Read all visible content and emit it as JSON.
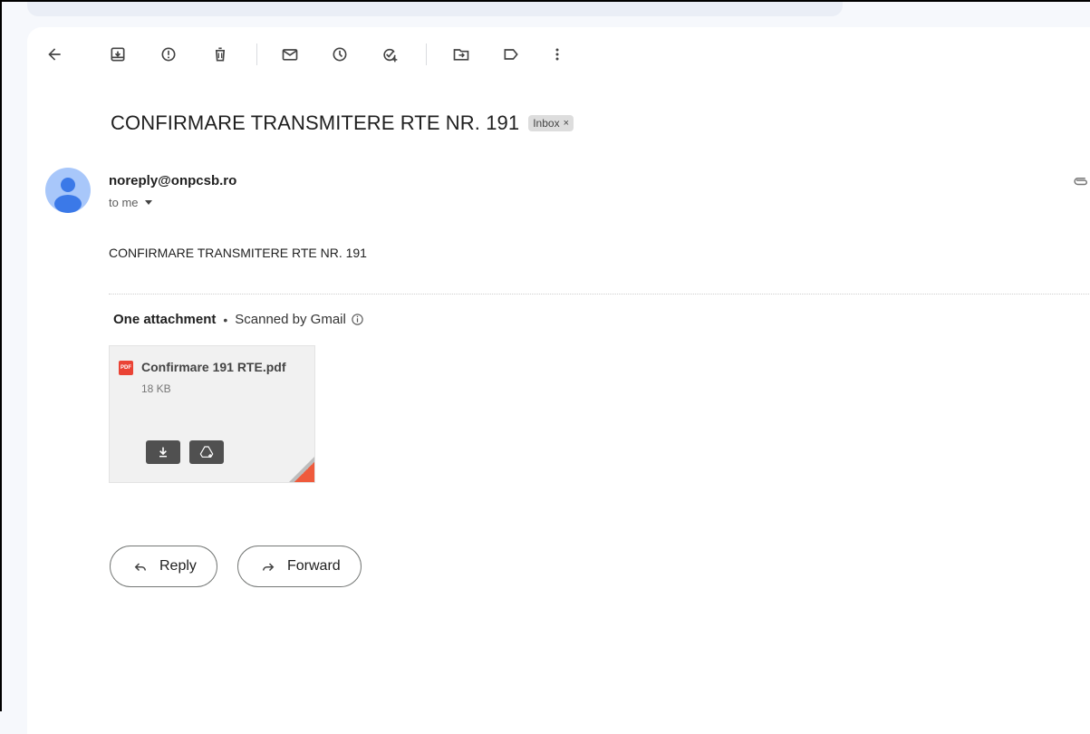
{
  "toolbar": {
    "buttons": [
      {
        "name": "back",
        "icon": "arrow-left-icon",
        "label": "Back"
      },
      {
        "name": "archive",
        "icon": "archive-icon",
        "label": "Archive"
      },
      {
        "name": "report-spam",
        "icon": "report-spam-icon",
        "label": "Report spam"
      },
      {
        "name": "delete",
        "icon": "trash-icon",
        "label": "Delete"
      },
      {
        "name": "mark-unread",
        "icon": "envelope-icon",
        "label": "Mark as unread"
      },
      {
        "name": "snooze",
        "icon": "clock-icon",
        "label": "Snooze"
      },
      {
        "name": "add-to-tasks",
        "icon": "add-task-icon",
        "label": "Add to Tasks"
      },
      {
        "name": "move-to",
        "icon": "move-folder-icon",
        "label": "Move to"
      },
      {
        "name": "labels",
        "icon": "label-icon",
        "label": "Labels"
      },
      {
        "name": "more",
        "icon": "more-vertical-icon",
        "label": "More"
      }
    ]
  },
  "message": {
    "subject": "CONFIRMARE TRANSMITERE RTE NR. 191",
    "label": "Inbox",
    "label_close": "×",
    "sender": "noreply@onpcsb.ro",
    "recipient": "to me",
    "body": "CONFIRMARE TRANSMITERE RTE NR. 191"
  },
  "attachments": {
    "count_text": "One attachment",
    "separator": "•",
    "scan_text": "Scanned by Gmail",
    "items": [
      {
        "type_badge": "PDF",
        "name": "Confirmare 191 RTE.pdf",
        "size": "18 KB"
      }
    ]
  },
  "actions": {
    "reply": "Reply",
    "forward": "Forward"
  },
  "colors": {
    "background": "#f6f8fc",
    "card": "#ffffff",
    "avatar": "#a8c7fa",
    "avatar_figure": "#3b79e8",
    "pdf_red": "#ea4335",
    "fold_red": "#ef5a3c"
  }
}
